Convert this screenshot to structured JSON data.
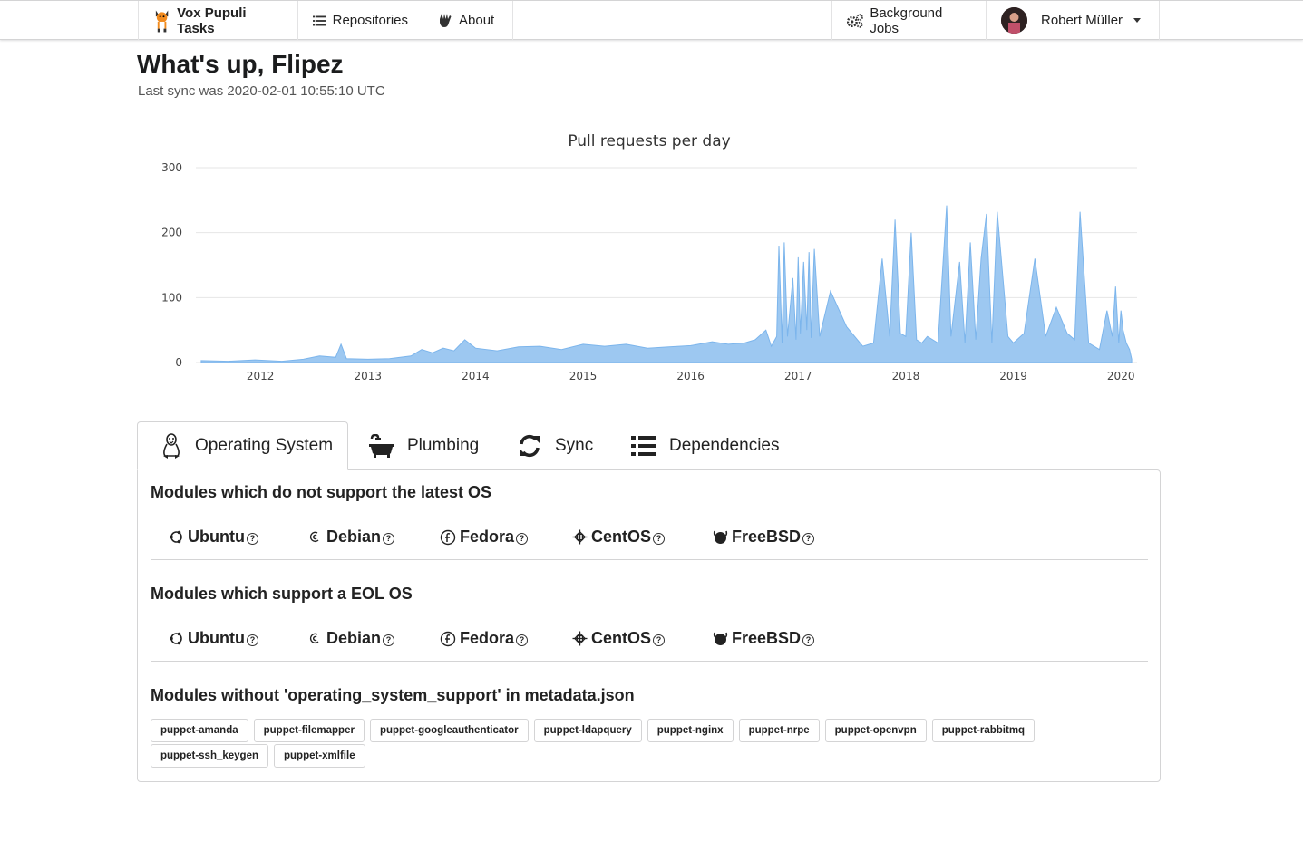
{
  "nav": {
    "brand": "Vox Pupuli Tasks",
    "repositories": "Repositories",
    "about": "About",
    "background_jobs": "Background Jobs",
    "user": "Robert Müller"
  },
  "header": {
    "title": "What's up, Flipez",
    "last_sync": "Last sync was 2020-02-01 10:55:10 UTC"
  },
  "chart_data": {
    "type": "area",
    "title": "Pull requests per day",
    "xlabel": "",
    "ylabel": "",
    "ylim": [
      0,
      300
    ],
    "yticks": [
      "0",
      "100",
      "200",
      "300"
    ],
    "xticks": [
      "2012",
      "2013",
      "2014",
      "2015",
      "2016",
      "2017",
      "2018",
      "2019",
      "2020"
    ],
    "xlim": [
      2011.4,
      2020.15
    ],
    "grid": true,
    "color": "#7cb5ec",
    "x": [
      2011.45,
      2011.7,
      2011.95,
      2012.2,
      2012.4,
      2012.55,
      2012.7,
      2012.75,
      2012.8,
      2013.0,
      2013.2,
      2013.4,
      2013.5,
      2013.6,
      2013.7,
      2013.8,
      2013.9,
      2014.0,
      2014.2,
      2014.4,
      2014.6,
      2014.8,
      2015.0,
      2015.2,
      2015.4,
      2015.6,
      2015.8,
      2016.0,
      2016.2,
      2016.35,
      2016.5,
      2016.6,
      2016.7,
      2016.75,
      2016.8,
      2016.82,
      2016.85,
      2016.87,
      2016.9,
      2016.95,
      2016.98,
      2017.0,
      2017.02,
      2017.05,
      2017.08,
      2017.1,
      2017.12,
      2017.15,
      2017.2,
      2017.3,
      2017.45,
      2017.6,
      2017.7,
      2017.78,
      2017.85,
      2017.9,
      2017.95,
      2018.0,
      2018.05,
      2018.1,
      2018.15,
      2018.2,
      2018.3,
      2018.38,
      2018.42,
      2018.5,
      2018.55,
      2018.6,
      2018.65,
      2018.7,
      2018.75,
      2018.8,
      2018.85,
      2018.95,
      2019.0,
      2019.1,
      2019.2,
      2019.3,
      2019.4,
      2019.5,
      2019.57,
      2019.62,
      2019.7,
      2019.8,
      2019.87,
      2019.92,
      2019.95,
      2019.98,
      2020.0,
      2020.02,
      2020.05,
      2020.08,
      2020.1
    ],
    "y": [
      3,
      2,
      4,
      2,
      5,
      10,
      8,
      28,
      6,
      5,
      6,
      10,
      20,
      15,
      22,
      18,
      35,
      22,
      18,
      24,
      25,
      20,
      28,
      25,
      28,
      22,
      24,
      26,
      32,
      28,
      30,
      35,
      50,
      25,
      40,
      180,
      30,
      185,
      40,
      130,
      35,
      162,
      45,
      155,
      50,
      170,
      38,
      175,
      40,
      110,
      55,
      25,
      30,
      160,
      40,
      220,
      45,
      40,
      200,
      35,
      30,
      40,
      30,
      242,
      40,
      155,
      30,
      185,
      35,
      160,
      229,
      30,
      232,
      40,
      30,
      45,
      160,
      40,
      85,
      45,
      35,
      232,
      30,
      20,
      80,
      40,
      117,
      30,
      80,
      50,
      30,
      20,
      5
    ]
  },
  "tabs": [
    {
      "label": "Operating System",
      "icon": "linux-icon"
    },
    {
      "label": "Plumbing",
      "icon": "bath-icon"
    },
    {
      "label": "Sync",
      "icon": "sync-icon"
    },
    {
      "label": "Dependencies",
      "icon": "list-icon"
    }
  ],
  "sections": {
    "latest_os": "Modules which do not support the latest OS",
    "eol_os": "Modules which support a EOL OS",
    "no_metadata": "Modules without 'operating_system_support' in metadata.json"
  },
  "os": [
    "Ubuntu",
    "Debian",
    "Fedora",
    "CentOS",
    "FreeBSD"
  ],
  "modules_without_metadata": [
    "puppet-amanda",
    "puppet-filemapper",
    "puppet-googleauthenticator",
    "puppet-ldapquery",
    "puppet-nginx",
    "puppet-nrpe",
    "puppet-openvpn",
    "puppet-rabbitmq",
    "puppet-ssh_keygen",
    "puppet-xmlfile"
  ]
}
